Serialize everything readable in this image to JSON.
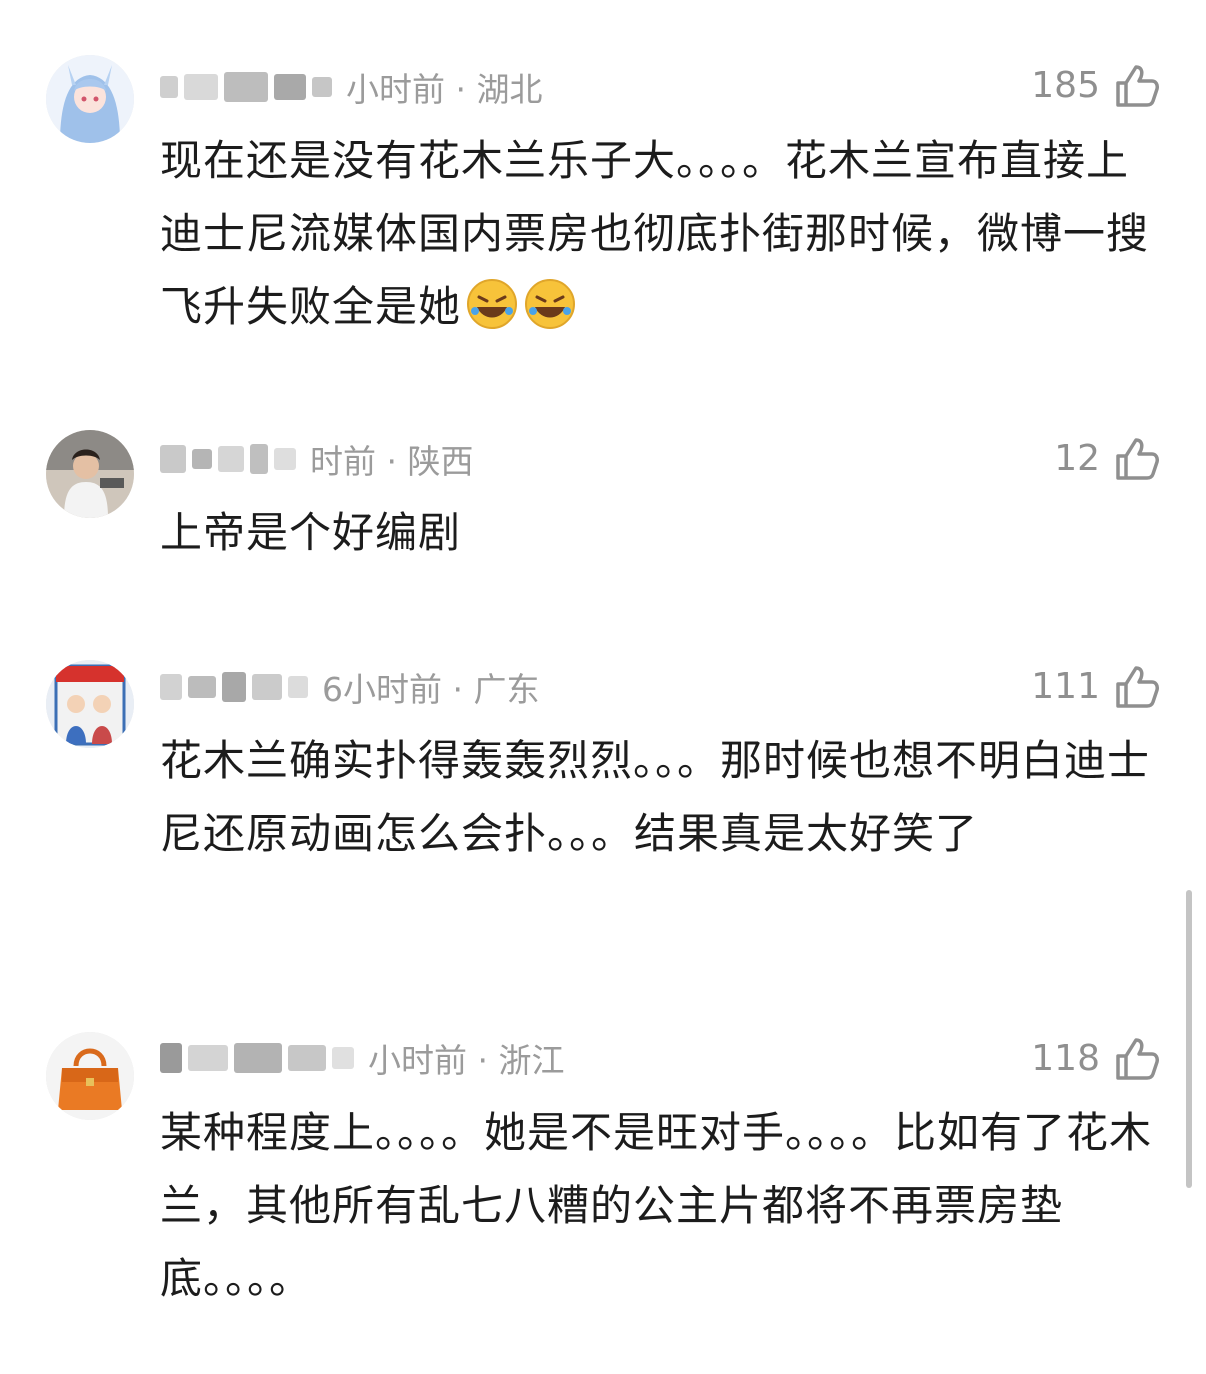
{
  "comments": [
    {
      "time_location": "小时前 · 湖北",
      "likes": "185",
      "text": "现在还是没有花木兰乐子大。。。。花木兰宣布直接上迪士尼流媒体国内票房也彻底扑街那时候，微博一搜飞升失败全是她",
      "emojis": [
        "rofl-emoji",
        "rofl-emoji"
      ]
    },
    {
      "time_location": "时前 · 陕西",
      "likes": "12",
      "text": "上帝是个好编剧"
    },
    {
      "time_location": "6小时前 · 广东",
      "likes": "111",
      "text": "花木兰确实扑得轰轰烈烈。。。那时候也想不明白迪士尼还原动画怎么会扑。。。结果真是太好笑了"
    },
    {
      "time_location": "小时前 · 浙江",
      "likes": "118",
      "text": "某种程度上。。。。她是不是旺对手。。。。比如有了花木兰，其他所有乱七八糟的公主片都将不再票房垫底。。。。"
    }
  ],
  "icons": {
    "like": "thumbs-up-icon",
    "emoji": "rofl-emoji"
  },
  "colors": {
    "meta": "#9b9b9b",
    "text": "#1c1c1c",
    "background": "#ffffff"
  }
}
